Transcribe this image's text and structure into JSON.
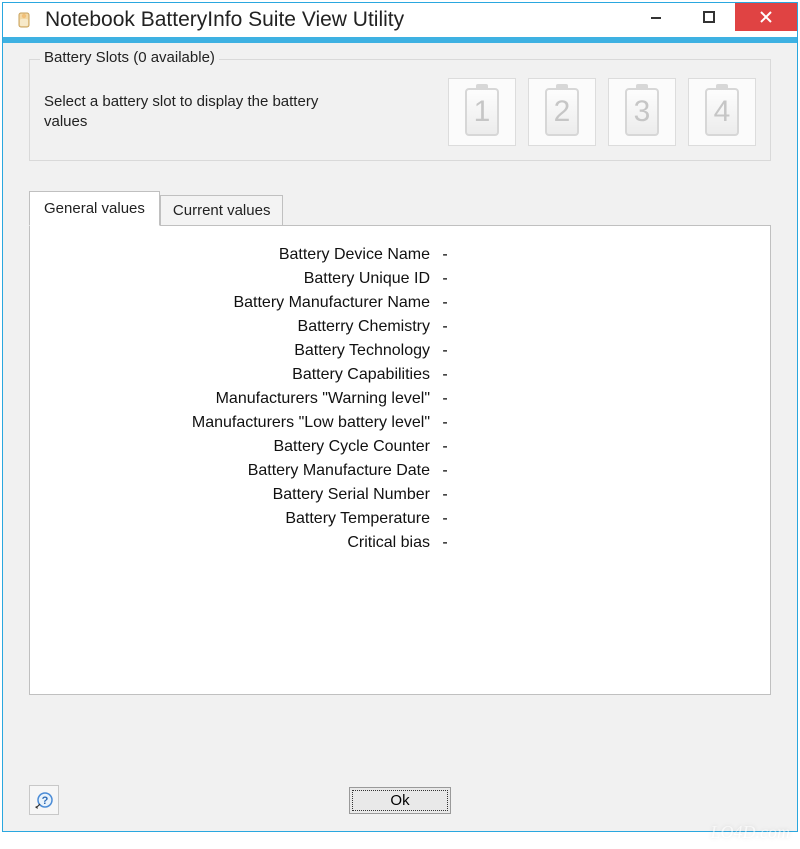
{
  "window": {
    "title": "Notebook BatteryInfo Suite View Utility"
  },
  "slots": {
    "legend": "Battery Slots (0 available)",
    "instruction": "Select a battery slot to display the battery values",
    "items": [
      {
        "num": "1"
      },
      {
        "num": "2"
      },
      {
        "num": "3"
      },
      {
        "num": "4"
      }
    ]
  },
  "tabs": {
    "general": "General values",
    "current": "Current values"
  },
  "general_values": [
    {
      "label": "Battery Device Name",
      "value": ""
    },
    {
      "label": "Battery Unique ID",
      "value": ""
    },
    {
      "label": "Battery Manufacturer Name",
      "value": ""
    },
    {
      "label": "Batterry Chemistry",
      "value": ""
    },
    {
      "label": "Battery Technology",
      "value": ""
    },
    {
      "label": "Battery Capabilities",
      "value": ""
    },
    {
      "label": "Manufacturers \"Warning level\"",
      "value": ""
    },
    {
      "label": "Manufacturers \"Low battery level\"",
      "value": ""
    },
    {
      "label": "Battery Cycle Counter",
      "value": ""
    },
    {
      "label": "Battery Manufacture Date",
      "value": ""
    },
    {
      "label": "Battery Serial Number",
      "value": ""
    },
    {
      "label": "Battery Temperature",
      "value": ""
    },
    {
      "label": "Critical bias",
      "value": ""
    }
  ],
  "buttons": {
    "ok": "Ok"
  },
  "watermark": "LO4D.com"
}
